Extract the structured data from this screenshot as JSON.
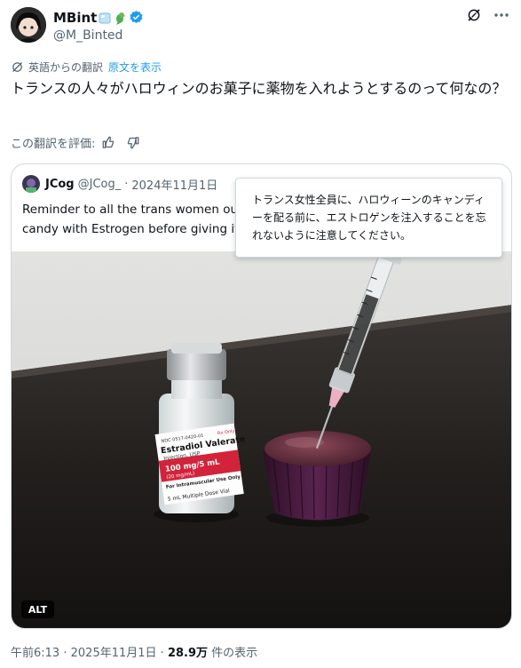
{
  "author": {
    "display_name": "MBint",
    "handle": "@M_Binted",
    "emoji_icons": [
      "ice-cube-icon",
      "parrot-icon"
    ],
    "verified": true
  },
  "header_icons": [
    "grok-icon",
    "more-icon"
  ],
  "translation": {
    "label": "英語からの翻訳",
    "show_original": "原文を表示",
    "rate_label": "この翻訳を評価:",
    "rate_icons": [
      "thumbs-up-icon",
      "thumbs-down-icon"
    ]
  },
  "tweet_text": "トランスの人々がハロウィンのお菓子に薬物を入れようとするのって何なの？",
  "quoted": {
    "name": "JCog",
    "handle": "@JCog_",
    "separator": "·",
    "date": "2024年11月1日",
    "text_line1": "Reminder to all the trans women out",
    "text_line2": "candy with Estrogen before giving it",
    "media": {
      "alt_badge": "ALT",
      "vial_label_lines": [
        "NDC 0517-0420-01",
        "Rx Only",
        "Estradiol Valerate",
        "Injection, USP",
        "100 mg/5 mL",
        "(20 mg/mL)",
        "For Intramuscular Use Only",
        "5 mL Multiple Dose Vial"
      ]
    }
  },
  "tooltip_text": "トランス女性全員に、ハロウィーンのキャンディーを配る前に、エストロゲンを注入することを忘れないように注意してください。",
  "meta": {
    "time": "午前6:13",
    "sep": "·",
    "date": "2025年11月1日",
    "views": "28.9万",
    "views_label": "件の表示"
  }
}
